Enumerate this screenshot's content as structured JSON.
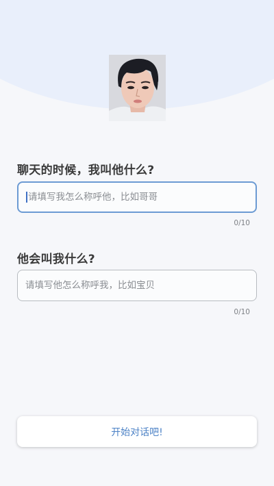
{
  "header": {
    "avatar_alt": "avatar"
  },
  "form": {
    "question1": "聊天的时候，我叫他什么?",
    "input1_placeholder": "请填写我怎么称呼他，比如哥哥",
    "input1_value": "",
    "counter1": "0/10",
    "question2": "他会叫我什么?",
    "input2_placeholder": "请填写他怎么称呼我，比如宝贝",
    "input2_value": "",
    "counter2": "0/10"
  },
  "actions": {
    "start_label": "开始对话吧!"
  },
  "colors": {
    "accent": "#4c82c6",
    "header_bg": "#e9effb",
    "focus_border": "#6b9ad3"
  }
}
